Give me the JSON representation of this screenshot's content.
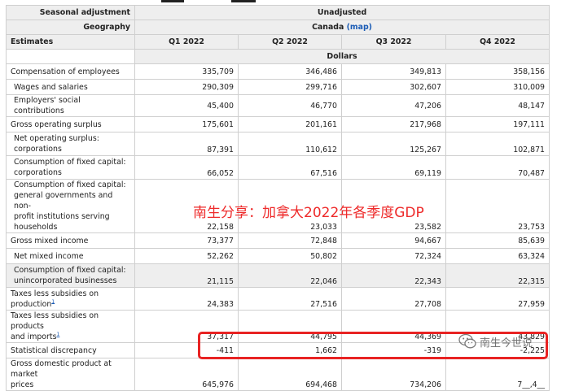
{
  "header": {
    "seasonal_label": "Seasonal adjustment",
    "seasonal_value": "Unadjusted",
    "geography_label": "Geography",
    "geography_value": "Canada",
    "map_link": "(map)",
    "estimates_label": "Estimates",
    "quarters": [
      "Q1 2022",
      "Q2 2022",
      "Q3 2022",
      "Q4 2022"
    ],
    "units": "Dollars"
  },
  "rows": [
    {
      "label": "Compensation of employees",
      "values": [
        "335,709",
        "346,486",
        "349,813",
        "358,156"
      ]
    },
    {
      "label": "Wages and salaries",
      "values": [
        "290,309",
        "299,716",
        "302,607",
        "310,009"
      ]
    },
    {
      "label": "Employers' social contributions",
      "values": [
        "45,400",
        "46,770",
        "47,206",
        "48,147"
      ]
    },
    {
      "label": "Gross operating surplus",
      "values": [
        "175,601",
        "201,161",
        "217,968",
        "197,111"
      ]
    },
    {
      "label_lines": [
        "Net operating surplus:",
        "corporations"
      ],
      "values": [
        "87,391",
        "110,612",
        "125,267",
        "102,871"
      ]
    },
    {
      "label_lines": [
        "Consumption of fixed capital:",
        "corporations"
      ],
      "values": [
        "66,052",
        "67,516",
        "69,119",
        "70,487"
      ]
    },
    {
      "label_lines": [
        "Consumption of fixed capital:",
        "general governments and non-",
        "profit institutions serving",
        "households"
      ],
      "values": [
        "22,158",
        "23,033",
        "23,582",
        "23,753"
      ]
    },
    {
      "label": "Gross mixed income",
      "values": [
        "73,377",
        "72,848",
        "94,667",
        "85,639"
      ]
    },
    {
      "label": "Net mixed income",
      "values": [
        "52,262",
        "50,802",
        "72,324",
        "63,324"
      ]
    },
    {
      "label_lines": [
        "Consumption of fixed capital:",
        "unincorporated businesses"
      ],
      "values": [
        "21,115",
        "22,046",
        "22,343",
        "22,315"
      ]
    },
    {
      "label_lines": [
        "Taxes less subsidies on",
        "production"
      ],
      "footnote": "1",
      "values": [
        "24,383",
        "27,516",
        "27,708",
        "27,959"
      ]
    },
    {
      "label_lines": [
        "Taxes less subsidies on products",
        "and imports"
      ],
      "footnote": "1",
      "values": [
        "37,317",
        "44,795",
        "44,369",
        "43,829"
      ]
    },
    {
      "label": "Statistical discrepancy",
      "values": [
        "-411",
        "1,662",
        "-319",
        "-2,225"
      ]
    },
    {
      "label_lines": [
        "Gross domestic product at market",
        "prices"
      ],
      "values": [
        "645,976",
        "694,468",
        "734,206",
        "7__,4__"
      ]
    }
  ],
  "watermark": "南生分享：加拿大2022年各季度GDP",
  "wechat_label": "南生今世说",
  "colors": {
    "highlight": "#e82323",
    "watermark": "#ee2a2a",
    "link": "#1a5bb5",
    "header_bg": "#eeeeee"
  }
}
